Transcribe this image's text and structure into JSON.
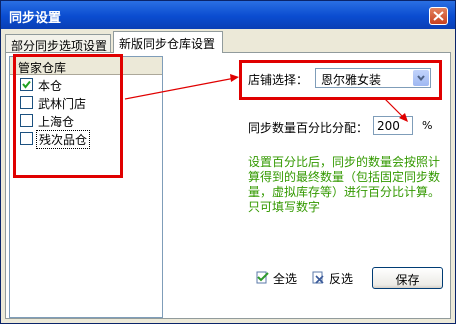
{
  "window": {
    "title": "同步设置"
  },
  "tabs": [
    {
      "label": "部分同步选项设置",
      "active": false
    },
    {
      "label": "新版同步仓库设置",
      "active": true
    }
  ],
  "warehouse_list": {
    "header": "管家仓库",
    "items": [
      {
        "label": "本仓",
        "checked": true
      },
      {
        "label": "武林门店",
        "checked": false
      },
      {
        "label": "上海仓",
        "checked": false
      },
      {
        "label": "残次品仓",
        "checked": false
      }
    ]
  },
  "store_select": {
    "label": "店铺选择：",
    "value": "恩尔雅女装"
  },
  "percent": {
    "label": "同步数量百分比分配：",
    "value": "200",
    "unit": "%"
  },
  "note": "设置百分比后，同步的数量会按照计算得到的最终数量（包括固定同步数量，虚拟库存等）进行百分比计算。只可填写数字",
  "buttons": {
    "select_all": "全选",
    "invert": "反选",
    "save": "保存"
  },
  "colors": {
    "annotation": "#e00000",
    "note_text": "#339900",
    "title_bar": "#0a4cd0"
  }
}
